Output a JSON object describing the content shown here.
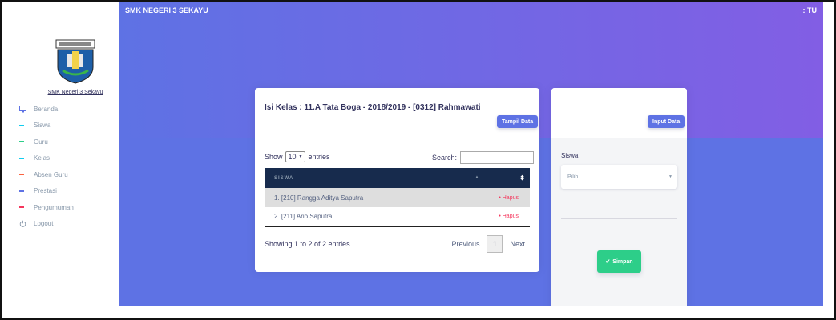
{
  "sidebar": {
    "school_name": "SMK Negeri 3 Sekayu",
    "items": [
      {
        "label": "Beranda",
        "icon": "monitor-icon",
        "color": "#5e72e4"
      },
      {
        "label": "Siswa",
        "icon": "dash-icon",
        "color": "#11cdef"
      },
      {
        "label": "Guru",
        "icon": "dash-icon",
        "color": "#2dce89"
      },
      {
        "label": "Kelas",
        "icon": "dash-icon",
        "color": "#11cdef"
      },
      {
        "label": "Absen Guru",
        "icon": "dash-icon",
        "color": "#fb6340"
      },
      {
        "label": "Prestasi",
        "icon": "dash-icon",
        "color": "#5e72e4"
      },
      {
        "label": "Pengumuman",
        "icon": "dash-icon",
        "color": "#f5365c"
      },
      {
        "label": "Logout",
        "icon": "power-icon",
        "color": "#8898aa"
      }
    ]
  },
  "header": {
    "brand": "SMK NEGERI 3 SEKAYU",
    "user": ": TU"
  },
  "class_card": {
    "title": "Isi Kelas : 11.A Tata Boga - 2018/2019 - [0312] Rahmawati",
    "show_button": "Tampil Data",
    "show_label": "Show",
    "entries_value": "10",
    "entries_label": "entries",
    "search_label": "Search:",
    "search_value": "",
    "table": {
      "column": "SISWA",
      "rows": [
        {
          "name": "1. [210] Rangga Aditya Saputra",
          "action": "• Hapus"
        },
        {
          "name": "2. [211] Ario Saputra",
          "action": "• Hapus"
        }
      ]
    },
    "info": "Showing 1 to 2 of 2 entries",
    "pagination": {
      "previous": "Previous",
      "current": "1",
      "next": "Next"
    }
  },
  "input_card": {
    "button": "Input Data",
    "field_label": "Siswa",
    "select_value": "Pilih",
    "save_button": "Simpan"
  },
  "colors": {
    "primary": "#5e72e4",
    "gradient_end": "#825ee4",
    "table_header": "#172b4d",
    "success": "#2dce89",
    "danger": "#f5365c"
  }
}
